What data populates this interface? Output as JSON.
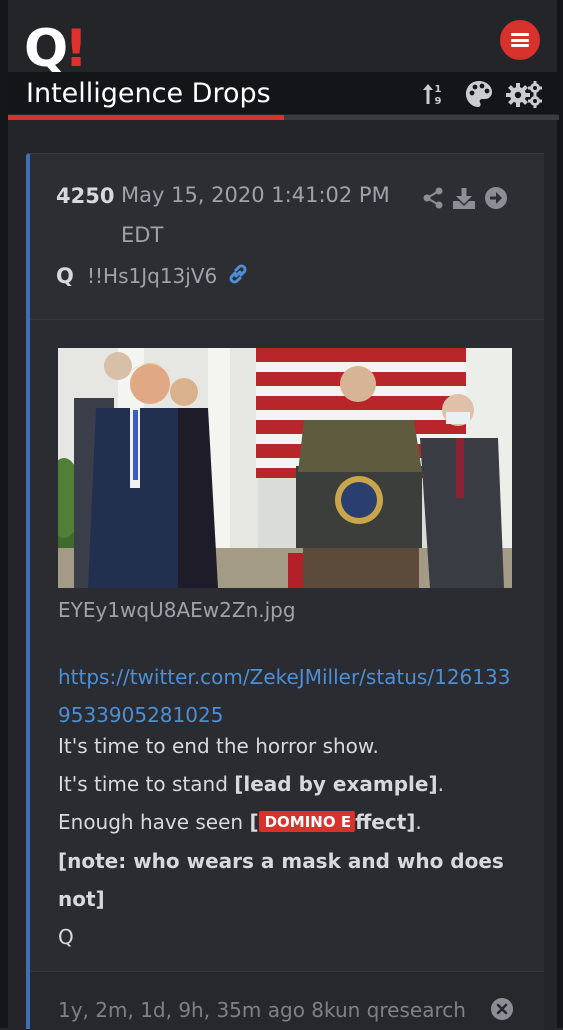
{
  "header": {
    "logo_text": "Q",
    "logo_mark": "!",
    "title": "Intelligence Drops",
    "scroll_progress_percent": 50,
    "icons": [
      "menu-icon",
      "sort-icon",
      "palette-icon",
      "settings-icon"
    ]
  },
  "post": {
    "number": "4250",
    "date": "May 15, 2020 1:41:02 PM EDT",
    "author": "Q",
    "tripcode": "!!Hs1Jq13jV6",
    "header_icons": [
      "share-icon",
      "download-icon",
      "goto-icon",
      "link-icon"
    ],
    "image_filename": "EYEy1wqU8AEw2Zn.jpg",
    "link": "https://twitter.com/ZekeJMiller/status/1261339533905281025",
    "lines": {
      "l1": "It's time to end the horror show.",
      "l2_pre": "It's time to stand ",
      "l2_bold": "[lead by example]",
      "l2_post": ".",
      "l3_pre": "Enough have seen ",
      "l3_bold_open": "[",
      "l3_badge": "DOMINO E",
      "l3_bold_rest": "ffect]",
      "l3_post": ".",
      "l4": "[note: who wears a mask and who does",
      "l5": "not]",
      "l6": "Q"
    },
    "footer": "1y, 2m, 1d, 9h, 35m ago 8kun qresearch"
  },
  "colors": {
    "accent_red": "#d8322c",
    "link_blue": "#4c8fd6",
    "card_border": "#3f6fb5",
    "background": "#232529"
  }
}
